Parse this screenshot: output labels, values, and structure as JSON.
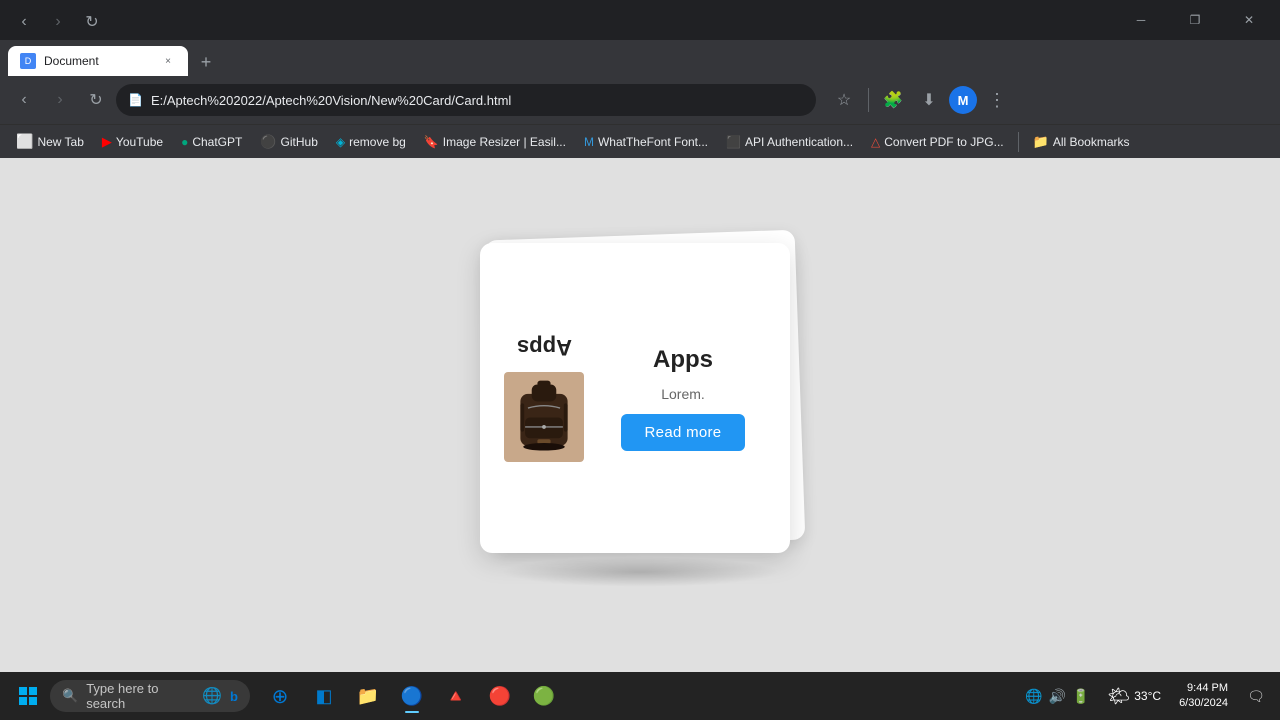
{
  "browser": {
    "tab": {
      "favicon": "D",
      "title": "Document",
      "close_label": "×"
    },
    "new_tab_label": "+",
    "nav": {
      "back": "‹",
      "forward": "›",
      "refresh": "↻"
    },
    "address_bar": {
      "icon": "🔒",
      "url": "E:/Aptech%202022/Aptech%20Vision/New%20Card/Card.html"
    },
    "toolbar_icons": {
      "bookmark": "☆",
      "extensions": "🧩",
      "download": "⬇",
      "menu": "⋮"
    },
    "profile": "M",
    "window_controls": {
      "minimize": "─",
      "maximize": "❐",
      "close": "✕"
    }
  },
  "bookmarks": [
    {
      "id": "new-tab",
      "label": "New Tab",
      "favicon": "+"
    },
    {
      "id": "youtube",
      "label": "YouTube",
      "color": "#ff0000"
    },
    {
      "id": "chatgpt",
      "label": "ChatGPT",
      "color": "#00a67d"
    },
    {
      "id": "github",
      "label": "GitHub",
      "color": "#333"
    },
    {
      "id": "removebg",
      "label": "remove bg",
      "color": "#00b4d8"
    },
    {
      "id": "image-resizer",
      "label": "Image Resizer | Easil...",
      "color": "#e67e22"
    },
    {
      "id": "whatthefont",
      "label": "WhatTheFont Font...",
      "color": "#3498db"
    },
    {
      "id": "api-auth",
      "label": "API Authentication...",
      "color": "#333"
    },
    {
      "id": "convert-pdf",
      "label": "Convert PDF to JPG...",
      "color": "#e74c3c"
    },
    {
      "id": "all-bookmarks",
      "label": "All Bookmarks"
    }
  ],
  "card": {
    "flipped_text": "Apps",
    "title": "Apps",
    "description": "Lorem.",
    "read_more_label": "Read more"
  },
  "taskbar": {
    "search_placeholder": "Type here to search",
    "clock": {
      "time": "9:44 PM",
      "date": "6/30/2024"
    },
    "weather": {
      "temp": "33°C",
      "icon": "🌤"
    }
  }
}
